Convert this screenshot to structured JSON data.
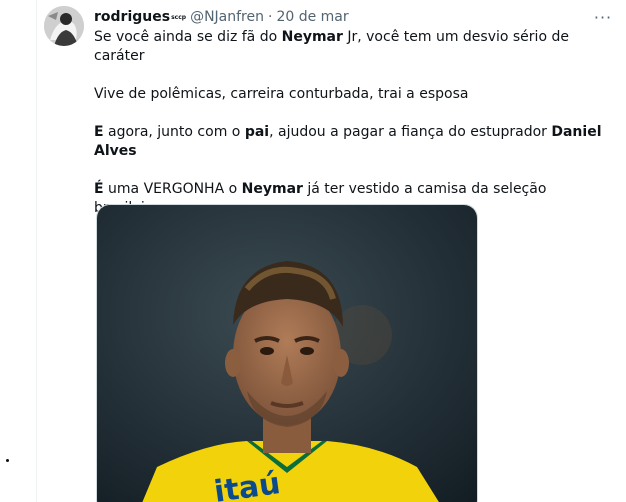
{
  "tweet": {
    "author": {
      "display_name": "rodrigues",
      "name_tag": "sccp",
      "handle": "@NJanfren",
      "avatar_icon": "profile-avatar-icon"
    },
    "separator": "·",
    "timestamp": "20 de mar",
    "more_icon": "more-options-icon",
    "more_glyph": "···",
    "paragraphs": [
      [
        {
          "text": "Se você ainda se diz fã do "
        },
        {
          "text": "Neymar",
          "bold": true
        },
        {
          "text": " Jr, você tem um desvio sério de caráter"
        }
      ],
      [
        {
          "text": "Vive de polêmicas, carreira conturbada, trai a esposa"
        }
      ],
      [
        {
          "text": "E",
          "bold": true
        },
        {
          "text": " agora, junto com o "
        },
        {
          "text": "pai",
          "bold": true
        },
        {
          "text": ", ajudou a pagar a fiança do estuprador "
        },
        {
          "text": "Daniel Alves",
          "bold": true
        }
      ],
      [
        {
          "text": "É",
          "bold": true
        },
        {
          "text": " uma VERGONHA o "
        },
        {
          "text": "Neymar",
          "bold": true
        },
        {
          "text": " já ter vestido a camisa da seleção brasileira"
        }
      ]
    ],
    "media": {
      "kind": "photo",
      "jersey_text": "itaú",
      "colors": {
        "background": "#1c2a33",
        "jersey": "#f2d20a",
        "skin": "#9a6a4a",
        "hair": "#3a2a1c"
      }
    }
  },
  "colors": {
    "text_primary": "#0f1419",
    "text_secondary": "#536471",
    "border": "#cfd9de"
  }
}
